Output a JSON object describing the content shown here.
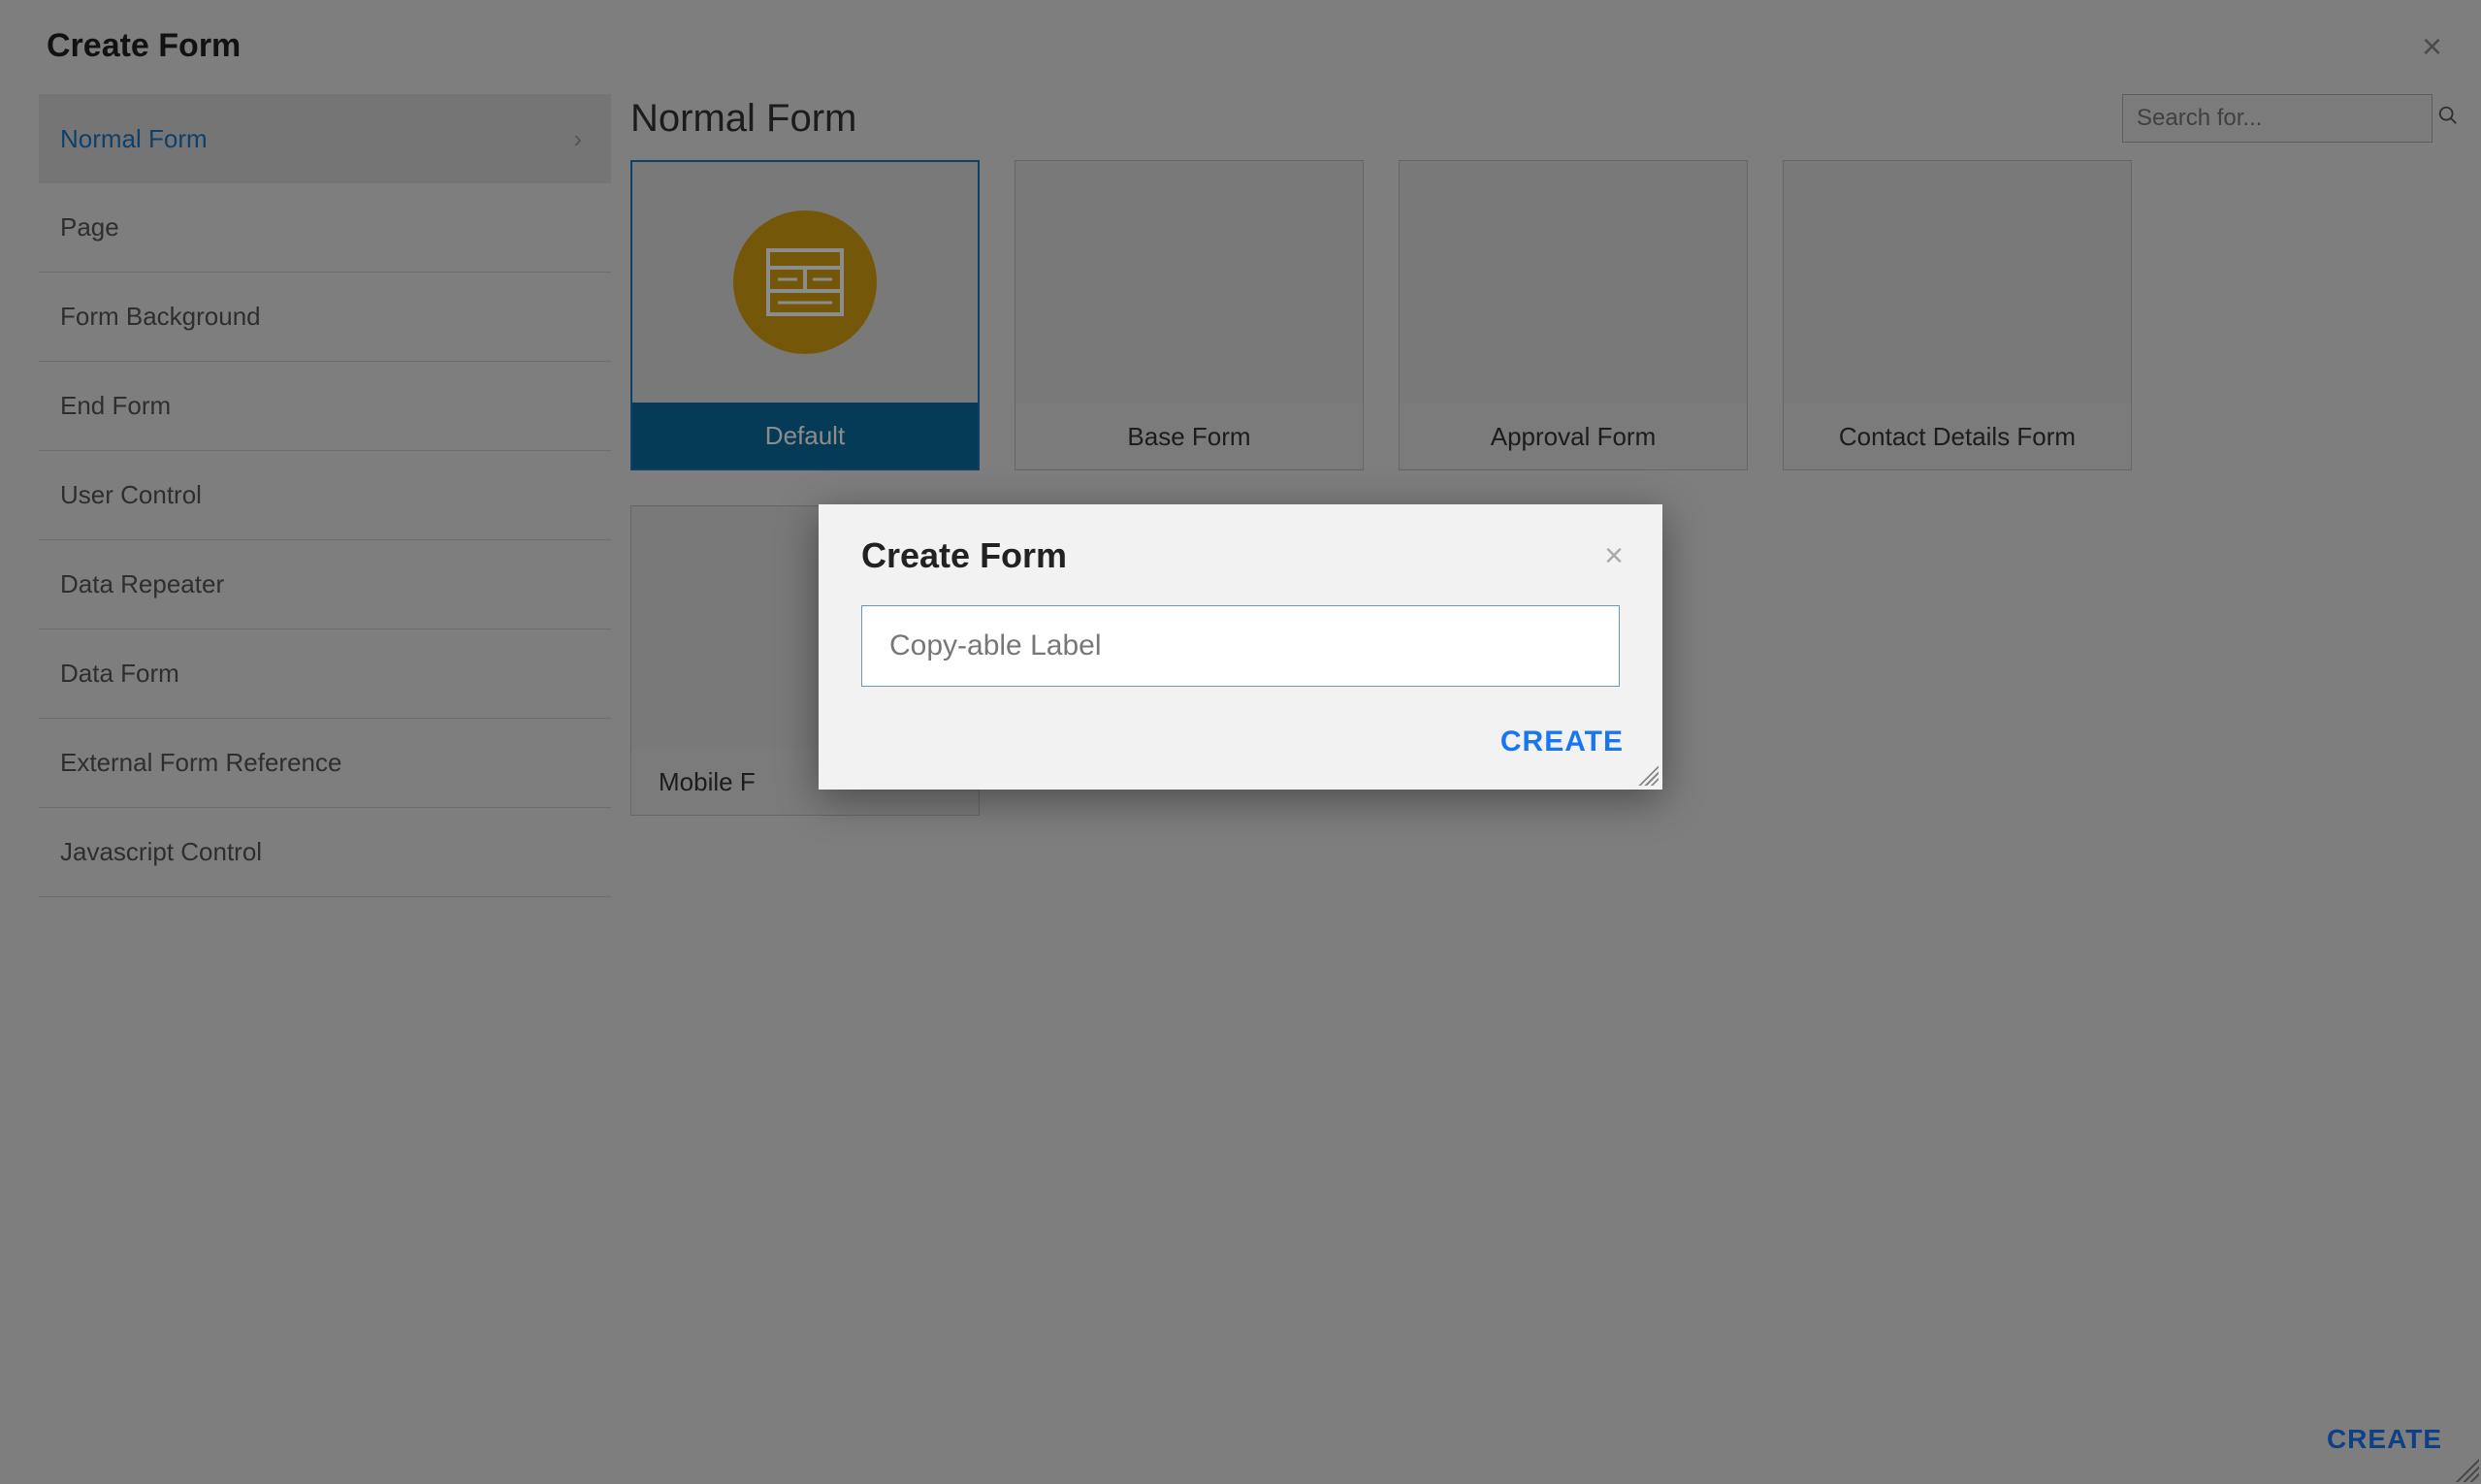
{
  "page": {
    "title": "Create Form",
    "close_icon": "×",
    "create_button": "CREATE"
  },
  "sidebar": {
    "items": [
      {
        "label": "Normal Form",
        "active": true
      },
      {
        "label": "Page"
      },
      {
        "label": "Form Background"
      },
      {
        "label": "End Form"
      },
      {
        "label": "User Control"
      },
      {
        "label": "Data Repeater"
      },
      {
        "label": "Data Form"
      },
      {
        "label": "External Form Reference"
      },
      {
        "label": "Javascript Control"
      }
    ]
  },
  "main": {
    "title": "Normal Form",
    "search_placeholder": "Search for...",
    "tiles": [
      {
        "label": "Default",
        "selected": true,
        "icon": "form-icon"
      },
      {
        "label": "Base Form"
      },
      {
        "label": "Approval Form"
      },
      {
        "label": "Contact Details Form"
      },
      {
        "label": "Mobile F"
      }
    ]
  },
  "modal": {
    "title": "Create Form",
    "input_value": "Copy-able Label",
    "create_button": "CREATE",
    "close_icon": "×"
  }
}
